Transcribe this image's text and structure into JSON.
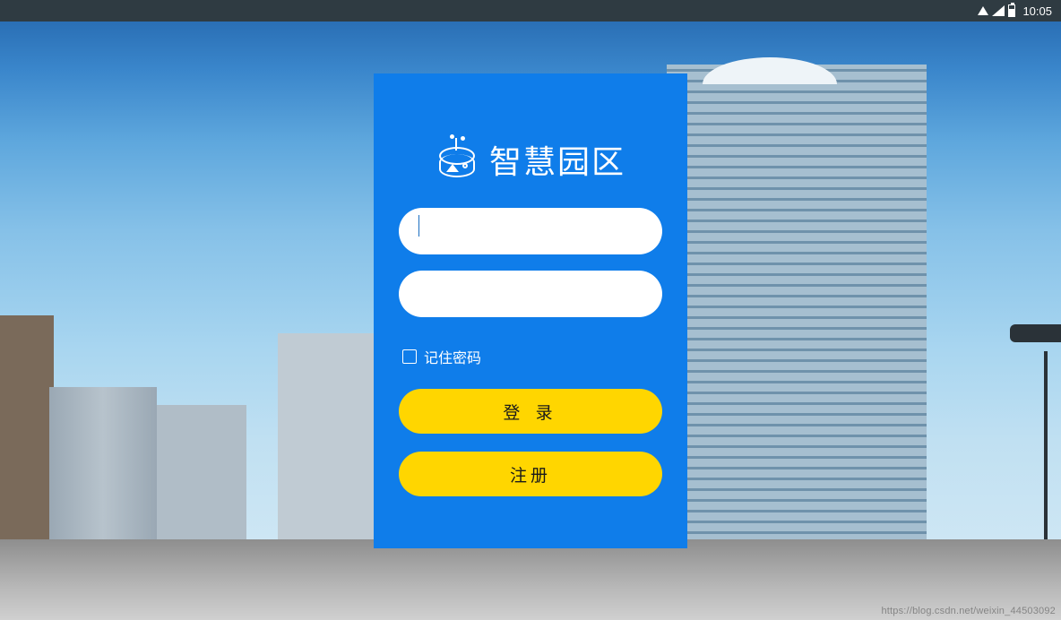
{
  "status": {
    "time": "10:05"
  },
  "brand": {
    "title": "智慧园区"
  },
  "form": {
    "username_value": "",
    "password_value": "",
    "remember_label": "记住密码"
  },
  "buttons": {
    "login": "登 录",
    "register": "注册"
  },
  "watermark": "https://blog.csdn.net/weixin_44503092"
}
